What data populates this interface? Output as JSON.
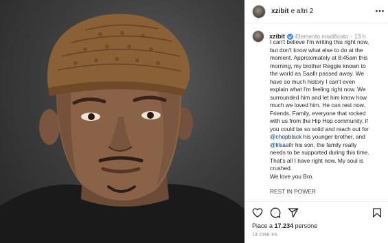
{
  "header": {
    "username": "xzibit",
    "others_text": "e altri 2"
  },
  "caption": {
    "username": "xzibit",
    "status": "Elemento modificato",
    "separator": "·",
    "time": "13 h",
    "lines": [
      "I can't believe I'm writing this right now,",
      "but don't know what else to do at the",
      "moment. Approximately at 8:45am this",
      "morning, my brother Reggie known to",
      "the world as Saafir passed away. We",
      "have so much history I can't even",
      "explain what I'm feeling right now. We",
      "surrounded him and let him know how",
      "much we loved him. He can rest now.",
      "Friends, Family, everyone that rocked",
      "with us from the Hip Hop community, if",
      "you could be so solid and reach out for"
    ],
    "line13": {
      "mention": "@chopblack",
      "rest": " his younger brother, and"
    },
    "line14": {
      "mention": "@lilsaafir",
      "rest": " his son, the family really"
    },
    "lines_after": [
      "needs to be supported during this time.",
      "That's all I have right now. My soul is",
      "crushed.",
      "We love you Bro."
    ],
    "rip": "REST IN POWER"
  },
  "actions": {
    "icons": [
      "heart-icon",
      "comment-icon",
      "share-icon",
      "bookmark-icon"
    ]
  },
  "likes": {
    "prefix": "Piace a",
    "count": "17.234",
    "suffix": "persone"
  },
  "time_ago": "14 ORE FA",
  "colors": {
    "verified": "#3897f0",
    "mention": "#00376b",
    "muted": "#8e8e8e",
    "border": "#efefef"
  }
}
